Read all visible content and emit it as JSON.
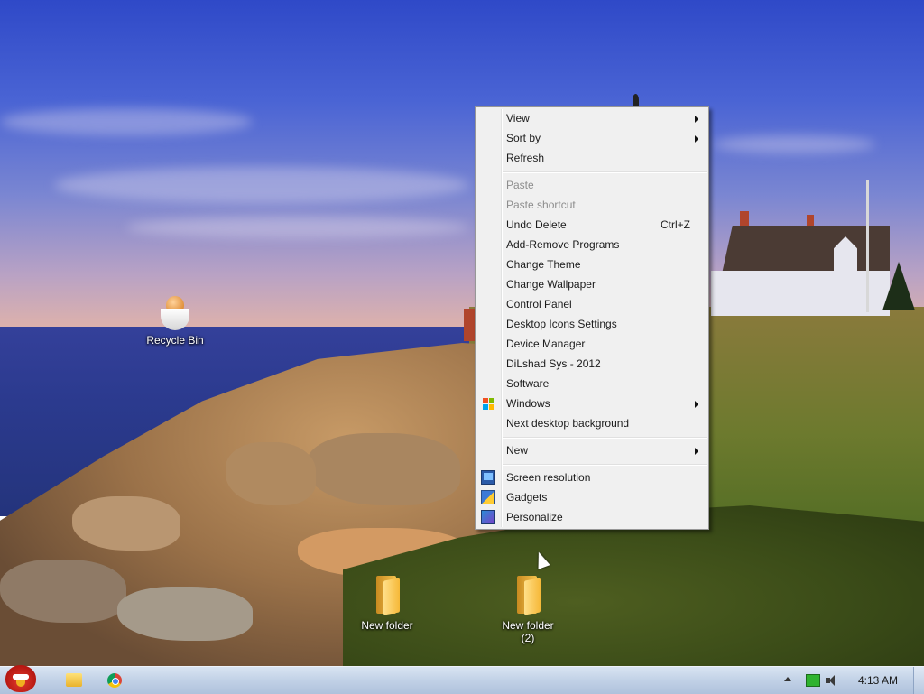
{
  "desktop": {
    "icons": [
      {
        "label": "Recycle Bin"
      },
      {
        "label": "New folder"
      },
      {
        "label": "New folder\n(2)"
      }
    ]
  },
  "context_menu": {
    "items": [
      {
        "label": "View",
        "submenu": true
      },
      {
        "label": "Sort by",
        "submenu": true
      },
      {
        "label": "Refresh"
      },
      {
        "label": "Paste",
        "disabled": true
      },
      {
        "label": "Paste shortcut",
        "disabled": true
      },
      {
        "label": "Undo Delete",
        "shortcut": "Ctrl+Z"
      },
      {
        "label": "Add-Remove Programs"
      },
      {
        "label": "Change Theme"
      },
      {
        "label": "Change Wallpaper"
      },
      {
        "label": "Control Panel"
      },
      {
        "label": "Desktop Icons Settings"
      },
      {
        "label": "Device Manager"
      },
      {
        "label": "DiLshad Sys - 2012"
      },
      {
        "label": "Software"
      },
      {
        "label": "Windows",
        "submenu": true,
        "icon": "windows-flag-icon"
      },
      {
        "label": "Next desktop background"
      },
      {
        "label": "New",
        "submenu": true
      },
      {
        "label": "Screen resolution",
        "icon": "monitor-icon"
      },
      {
        "label": "Gadgets",
        "icon": "gadgets-icon"
      },
      {
        "label": "Personalize",
        "icon": "personalize-icon"
      }
    ]
  },
  "taskbar": {
    "apps": [
      {
        "icon": "angry-bird-start-icon"
      },
      {
        "icon": "windows-explorer-icon"
      },
      {
        "icon": "chrome-icon"
      }
    ],
    "tray": {
      "clock": "4:13 AM",
      "icons": [
        "show-hidden-icons-chevron-icon",
        "network-icon",
        "volume-icon"
      ]
    }
  },
  "colors": {
    "menu_background": "#f0f0f0",
    "menu_border": "#979797",
    "disabled_text": "#8d8d8d",
    "taskbar_top": "#d9e4f2",
    "taskbar_bottom": "#afc2dc"
  }
}
